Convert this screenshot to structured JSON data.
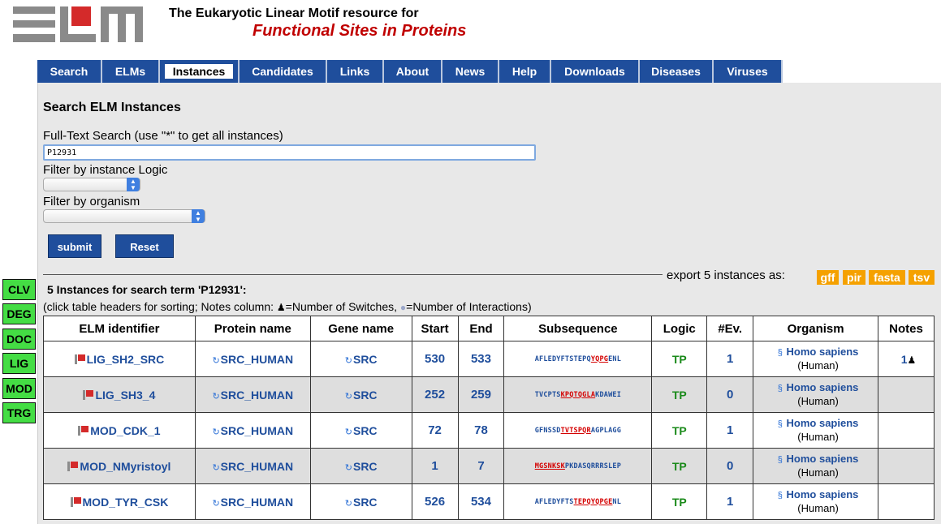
{
  "header": {
    "line1": "The Eukaryotic Linear Motif resource for",
    "line2": "Functional Sites in Proteins"
  },
  "nav": {
    "tabs": [
      {
        "label": "Search",
        "active": false
      },
      {
        "label": "ELMs",
        "active": false
      },
      {
        "label": "Instances",
        "active": true
      },
      {
        "label": "Candidates",
        "active": false
      },
      {
        "label": "Links",
        "active": false
      },
      {
        "label": "About",
        "active": false
      },
      {
        "label": "News",
        "active": false
      },
      {
        "label": "Help",
        "active": false
      },
      {
        "label": "Downloads",
        "active": false
      },
      {
        "label": "Diseases",
        "active": false
      },
      {
        "label": "Viruses",
        "active": false
      }
    ]
  },
  "search": {
    "title": "Search ELM Instances",
    "fulltext_label": "Full-Text Search (use \"*\" to get all instances)",
    "fulltext_value": "P12931",
    "logic_label": "Filter by instance Logic",
    "logic_value": "",
    "organism_label": "Filter by organism",
    "organism_value": "",
    "submit_label": "submit",
    "reset_label": "Reset"
  },
  "export": {
    "label": "export 5 instances as:",
    "formats": [
      "gff",
      "pir",
      "fasta",
      "tsv"
    ]
  },
  "results": {
    "title": "5 Instances for search term 'P12931':",
    "note_prefix": "(click table headers for sorting; Notes column: ",
    "note_switches": "=Number of Switches, ",
    "note_interactions": "=Number of Interactions)"
  },
  "side_tabs": [
    "CLV",
    "DEG",
    "DOC",
    "LIG",
    "MOD",
    "TRG"
  ],
  "table": {
    "headers": [
      "ELM identifier",
      "Protein name",
      "Gene name",
      "Start",
      "End",
      "Subsequence",
      "Logic",
      "#Ev.",
      "Organism",
      "Notes"
    ],
    "rows": [
      {
        "elm": "LIG_SH2_SRC",
        "protein": "SRC_HUMAN",
        "gene": "SRC",
        "start": "530",
        "end": "533",
        "seq_pre": "AFLEDYFTSTEPQ",
        "seq_hl": "YQPG",
        "seq_post": "ENL",
        "logic": "TP",
        "ev": "1",
        "species": "Homo sapiens",
        "common": "(Human)",
        "notes": "1"
      },
      {
        "elm": "LIG_SH3_4",
        "protein": "SRC_HUMAN",
        "gene": "SRC",
        "start": "252",
        "end": "259",
        "seq_pre": "TVCPTS",
        "seq_hl": "KPQTQGLA",
        "seq_post": "KDAWEI",
        "logic": "TP",
        "ev": "0",
        "species": "Homo sapiens",
        "common": "(Human)",
        "notes": ""
      },
      {
        "elm": "MOD_CDK_1",
        "protein": "SRC_HUMAN",
        "gene": "SRC",
        "start": "72",
        "end": "78",
        "seq_pre": "GFNSSD",
        "seq_hl": "TVTSPQR",
        "seq_post": "AGPLAGG",
        "logic": "TP",
        "ev": "1",
        "species": "Homo sapiens",
        "common": "(Human)",
        "notes": ""
      },
      {
        "elm": "MOD_NMyristoyl",
        "protein": "SRC_HUMAN",
        "gene": "SRC",
        "start": "1",
        "end": "7",
        "seq_pre": "",
        "seq_hl": "MGSNKSK",
        "seq_post": "PKDASQRRRSLEP",
        "logic": "TP",
        "ev": "0",
        "species": "Homo sapiens",
        "common": "(Human)",
        "notes": ""
      },
      {
        "elm": "MOD_TYR_CSK",
        "protein": "SRC_HUMAN",
        "gene": "SRC",
        "start": "526",
        "end": "534",
        "seq_pre": "AFLEDYFTS",
        "seq_hl": "TEPQYQPGE",
        "seq_post": "NL",
        "logic": "TP",
        "ev": "1",
        "species": "Homo sapiens",
        "common": "(Human)",
        "notes": ""
      }
    ]
  },
  "colors": {
    "nav_blue": "#1f4e9c",
    "brand_red": "#c00000",
    "export_orange": "#f5a100",
    "side_green": "#44dd44",
    "logic_green": "#1a8a1a"
  }
}
